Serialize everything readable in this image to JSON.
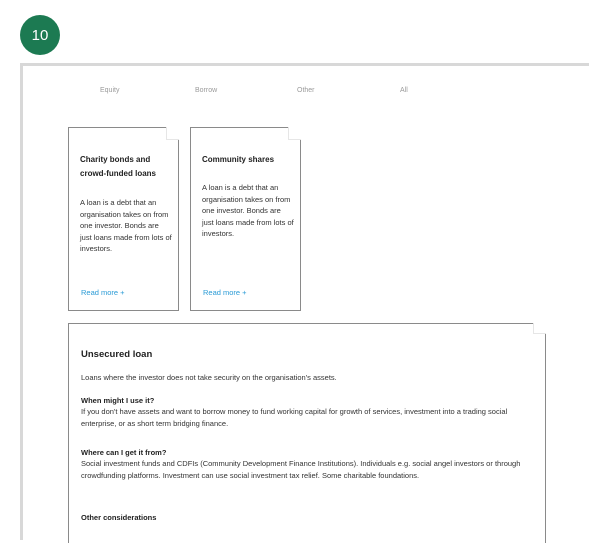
{
  "step": {
    "number": "10"
  },
  "tabs": [
    "Equity",
    "Borrow",
    "Other",
    "All"
  ],
  "cards": [
    {
      "title": "Charity bonds and crowd-funded loans",
      "body": "A loan is a debt that an organisation takes on from one investor. Bonds are just loans made from lots of investors.",
      "link": "Read more +"
    },
    {
      "title": "Community shares",
      "body": "A loan is a debt that an organisation takes on from one investor. Bonds are just loans made from lots of investors.",
      "link": "Read more +"
    }
  ],
  "detail": {
    "title": "Unsecured loan",
    "intro": "Loans where the investor does not take security on the organisation's assets.",
    "sections": [
      {
        "heading": "When might I use it?",
        "text": "If you don't have assets and want to borrow money to fund working capital for growth of services, investment into a trading social enterprise, or as short term bridging finance."
      },
      {
        "heading": "Where can I get it from?",
        "text": "Social investment funds and CDFIs (Community Development Finance Institutions). Individuals e.g. social angel investors or through crowdfunding platforms. Investment can use social investment tax relief. Some charitable foundations."
      },
      {
        "heading": "Other considerations",
        "text": ""
      }
    ]
  },
  "colors": {
    "badge": "#1c7a52",
    "link": "#2a9bd6",
    "tab": "#9a9a9a"
  }
}
